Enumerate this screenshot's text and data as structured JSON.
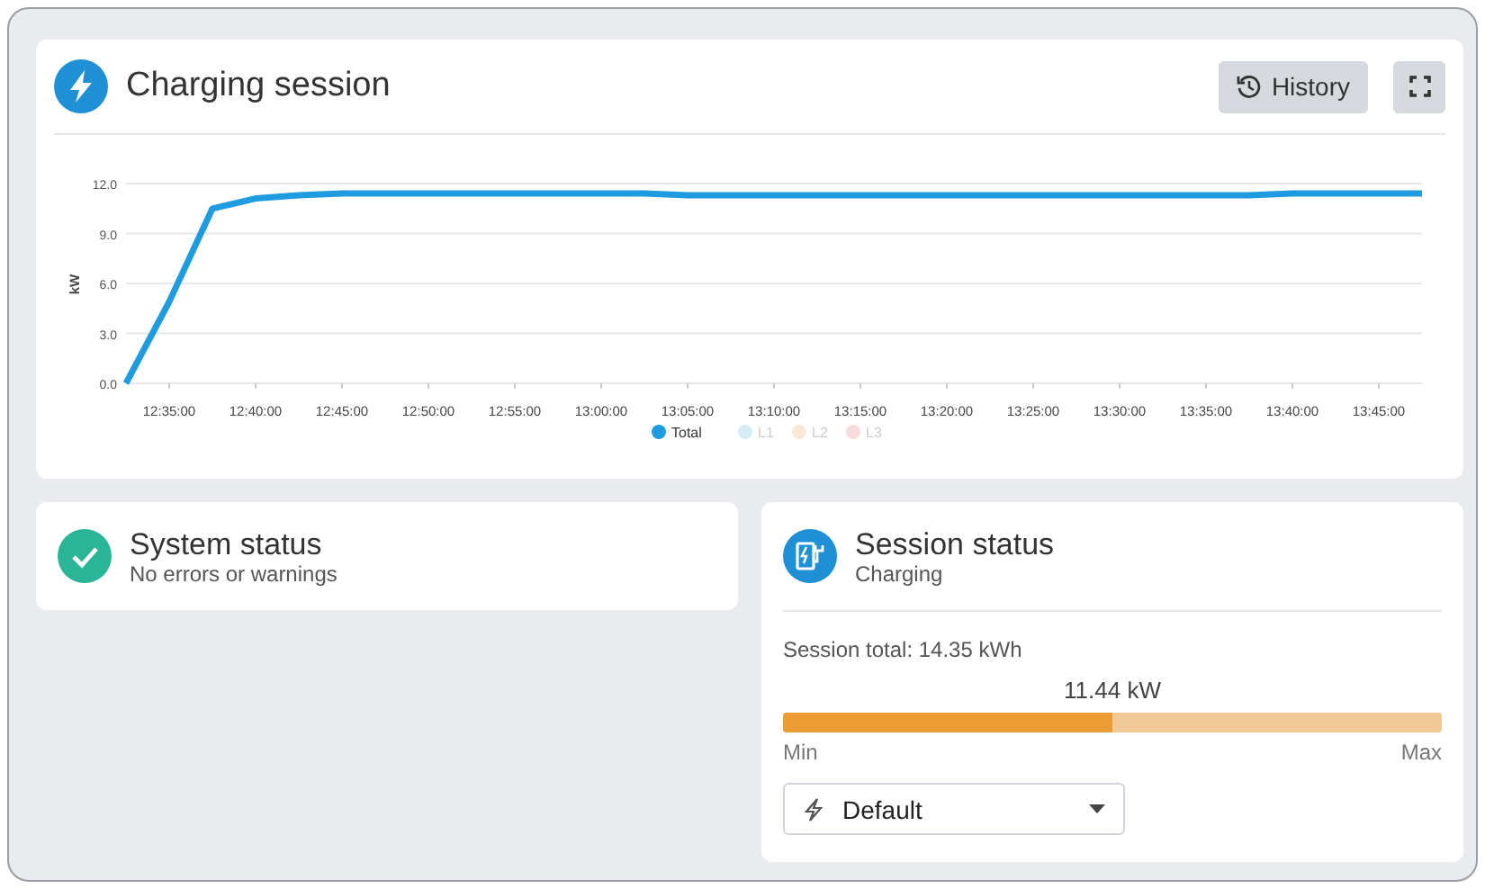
{
  "charging_card": {
    "title": "Charging session",
    "history_button": "History",
    "chart_data": {
      "type": "line",
      "ylabel": "kW",
      "grid": true,
      "categories": [
        null,
        "12:35:00",
        null,
        "12:40:00",
        null,
        "12:45:00",
        null,
        "12:50:00",
        null,
        "12:55:00",
        null,
        "13:00:00",
        null,
        "13:05:00",
        null,
        "13:10:00",
        null,
        "13:15:00",
        null,
        "13:20:00",
        null,
        "13:25:00",
        null,
        "13:30:00",
        null,
        "13:35:00",
        null,
        "13:40:00",
        null,
        "13:45:00",
        null
      ],
      "series": [
        {
          "name": "Total",
          "color": "#1f9be0",
          "values": [
            0,
            4.9,
            10.5,
            11.1,
            11.3,
            11.4,
            11.4,
            11.4,
            11.4,
            11.4,
            11.4,
            11.4,
            11.4,
            11.3,
            11.3,
            11.3,
            11.3,
            11.3,
            11.3,
            11.3,
            11.3,
            11.3,
            11.3,
            11.3,
            11.3,
            11.3,
            11.3,
            11.4,
            11.4,
            11.4,
            11.4
          ]
        },
        {
          "name": "L1",
          "color": "#a8dde8",
          "values": [
            null,
            null,
            null,
            null,
            null,
            null,
            null,
            null,
            null,
            null,
            null,
            null,
            null,
            null,
            null,
            null,
            null,
            null,
            null,
            null,
            null,
            null,
            null,
            null,
            null,
            null,
            null,
            null,
            null,
            null,
            null
          ]
        },
        {
          "name": "L2",
          "color": "#f5d3a8",
          "values": [
            null,
            null,
            null,
            null,
            null,
            null,
            null,
            null,
            null,
            null,
            null,
            null,
            null,
            null,
            null,
            null,
            null,
            null,
            null,
            null,
            null,
            null,
            null,
            null,
            null,
            null,
            null,
            null,
            null,
            null,
            null
          ]
        },
        {
          "name": "L3",
          "color": "#f2b8bf",
          "values": [
            null,
            null,
            null,
            null,
            null,
            null,
            null,
            null,
            null,
            null,
            null,
            null,
            null,
            null,
            null,
            null,
            null,
            null,
            null,
            null,
            null,
            null,
            null,
            null,
            null,
            null,
            null,
            null,
            null,
            null,
            null
          ]
        }
      ],
      "ylim": [
        0,
        12
      ],
      "yticks": [
        {
          "value": 0,
          "label": "0.0"
        },
        {
          "value": 3,
          "label": "3.0"
        },
        {
          "value": 6,
          "label": "6.0"
        },
        {
          "value": 9,
          "label": "9.0"
        },
        {
          "value": 12,
          "label": "12.0"
        }
      ]
    }
  },
  "system_status": {
    "title": "System status",
    "subtitle": "No errors or warnings"
  },
  "session_status": {
    "title": "Session status",
    "subtitle": "Charging",
    "total": "Session total: 14.35 kWh",
    "power": "11.44 kW",
    "level": 0.5,
    "min_label": "Min",
    "max_label": "Max",
    "mode_select": "Default"
  }
}
